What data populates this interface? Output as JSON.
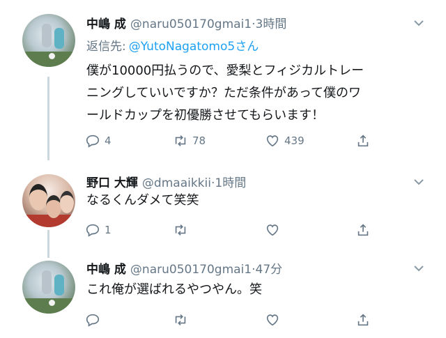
{
  "tweets": [
    {
      "name": "中嶋 成",
      "handle": "@naru050170gmai1",
      "separator": "·",
      "time": "3時間",
      "reply_label": "返信先:",
      "reply_to": "@YutoNagatomo5さん",
      "text_lines": [
        "僕が10000円払うので、愛梨とフィジカルトレー",
        "ニングしていいですか？ただ条件があって僕のワ",
        "ールドカップを初優勝させてもらいます！"
      ],
      "reply_count": "4",
      "retweet_count": "78",
      "like_count": "439"
    },
    {
      "name": "野口 大輝",
      "handle": "@dmaaikkii",
      "separator": "·",
      "time": "1時間",
      "text_lines": [
        "なるくんダメて笑笑"
      ],
      "reply_count": "1",
      "retweet_count": "",
      "like_count": ""
    },
    {
      "name": "中嶋 成",
      "handle": "@naru050170gmai1",
      "separator": "·",
      "time": "47分",
      "text_lines": [
        "これ俺が選ばれるやつやん。笑"
      ],
      "reply_count": "",
      "retweet_count": "",
      "like_count": ""
    }
  ],
  "icons": {
    "reply": "reply-icon",
    "retweet": "retweet-icon",
    "like": "like-icon",
    "share": "share-icon",
    "more": "chevron-down-icon"
  },
  "colors": {
    "text": "#14171a",
    "secondary": "#657786",
    "link": "#1da1f2",
    "thread_line": "#ccd6dd"
  }
}
